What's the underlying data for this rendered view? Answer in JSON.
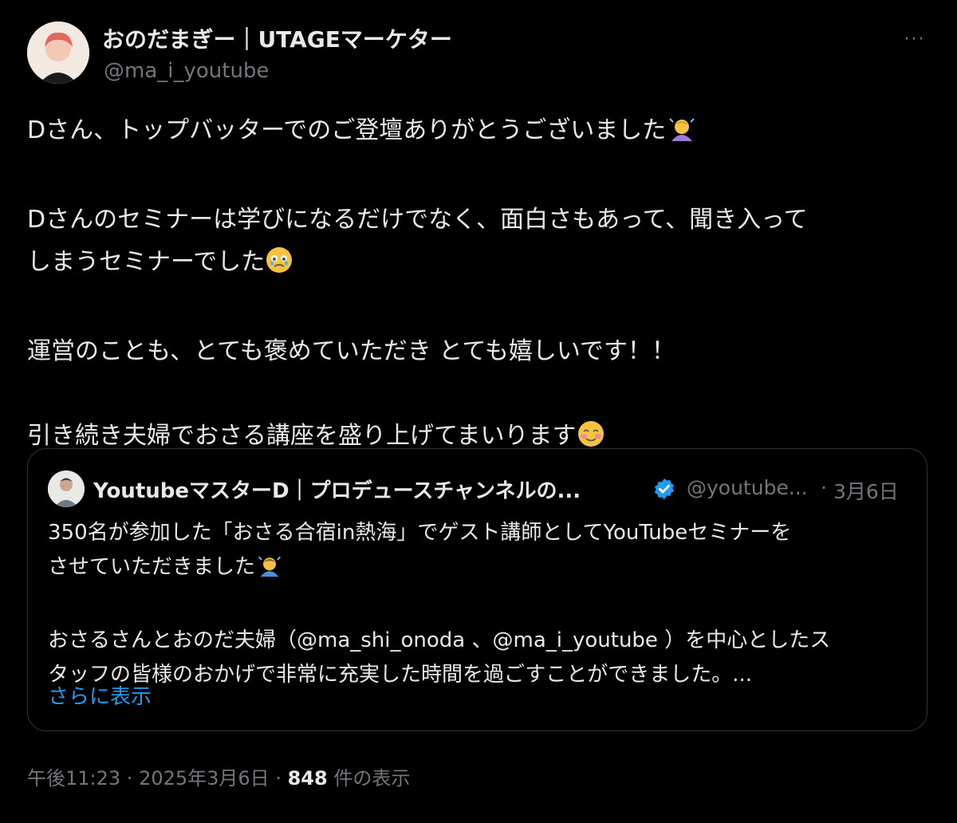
{
  "author": {
    "display_name": "おのだまぎー｜UTAGEマーケター",
    "handle": "@ma_i_youtube",
    "more_label": "···"
  },
  "tweet": {
    "line1": "Dさん、トップバッターでのご登壇ありがとうございました",
    "line2a": "Dさんのセミナーは学びになるだけでなく、面白さもあって、聞き入って",
    "line2b": "しまうセミナーでした",
    "line3": "運営のことも、とても褒めていただき とても嬉しいです！！",
    "line4": "引き続き夫婦でおさる講座を盛り上げてまいります"
  },
  "quote": {
    "name": "YoutubeマスターD｜プロデュースチャンネルの...",
    "handle": "@youtube...",
    "separator": "·",
    "date": "3月6日",
    "line1": "350名が参加した「おさる合宿in熱海」でゲスト講師としてYouTubeセミナーを",
    "line2": "させていただきました",
    "line3": "おさるさんとおのだ夫婦（@ma_shi_onoda 、@ma_i_youtube ）を中心としたス",
    "line4": "タッフの皆様のおかげで非常に充実した時間を過ごすことができました。...",
    "show_more": "さらに表示"
  },
  "meta": {
    "time": "午後11:23",
    "sep1": " · ",
    "date": "2025年3月6日",
    "sep2": " · ",
    "views": "848",
    "views_label": " 件の表示"
  },
  "icons": {
    "emoji1": "person-bowing-icon",
    "emoji2": "face-holding-back-tears-icon",
    "emoji3": "smiling-face-icon",
    "emoji4": "person-bowing-icon",
    "verified": "verified-badge-icon"
  },
  "colors": {
    "background": "#000000",
    "text": "#e7e9ea",
    "secondary": "#71767b",
    "link": "#1d9bf0",
    "border": "#2f3336"
  }
}
